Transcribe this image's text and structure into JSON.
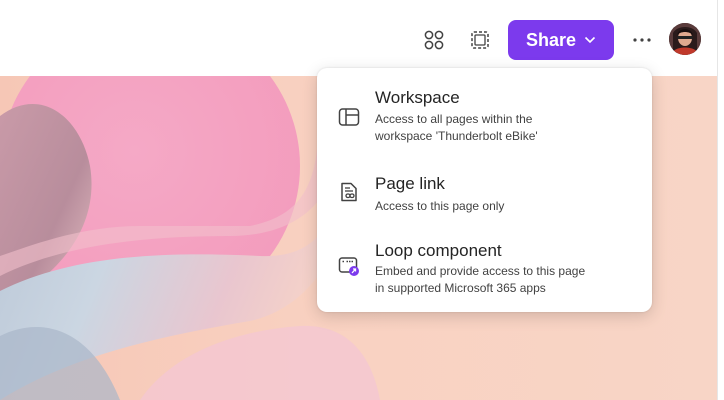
{
  "toolbar": {
    "apps_icon": "apps-icon",
    "capture_icon": "screen-capture-icon",
    "share_label": "Share",
    "share_chevron_icon": "chevron-down-icon",
    "more_icon": "more-horizontal-icon",
    "avatar_icon": "user-avatar",
    "accent_color": "#7c3aed"
  },
  "share_menu": {
    "items": [
      {
        "icon": "workspace-icon",
        "title": "Workspace",
        "description_line1": "Access to all pages within the",
        "description_line2": "workspace 'Thunderbolt eBike'"
      },
      {
        "icon": "page-link-icon",
        "title": "Page link",
        "description_line1": "Access to this page only"
      },
      {
        "icon": "loop-component-icon",
        "title": "Loop component",
        "description_line1": "Embed and provide access to this page",
        "description_line2": "in supported Microsoft 365 apps"
      }
    ]
  }
}
